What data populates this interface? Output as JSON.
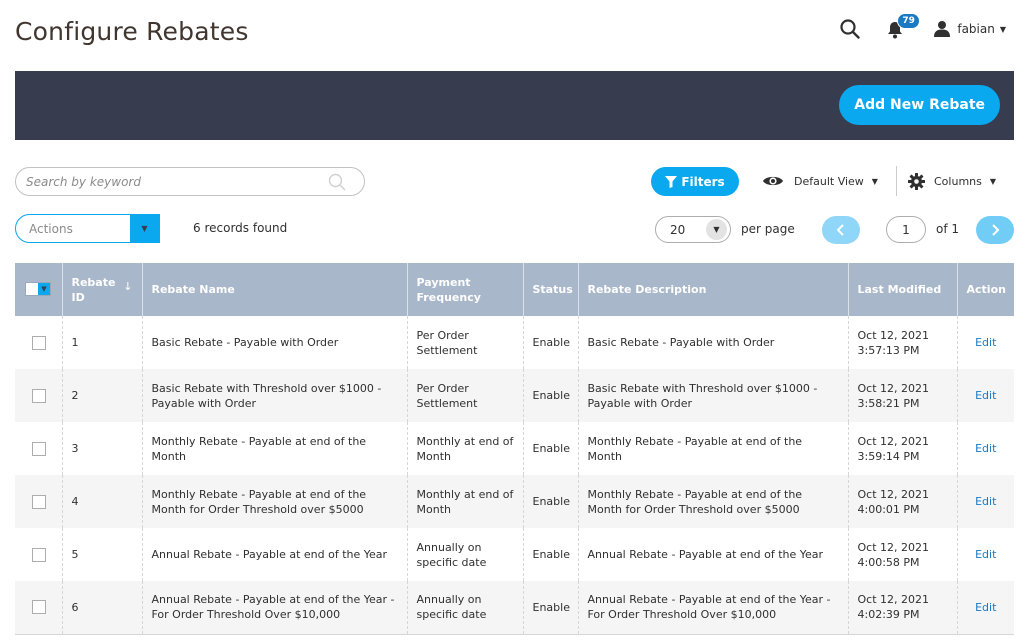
{
  "page": {
    "title": "Configure Rebates"
  },
  "header": {
    "notifications_count": "79",
    "username": "fabian"
  },
  "toolbar": {
    "add_button": "Add New Rebate",
    "search_placeholder": "Search by keyword",
    "filters_label": "Filters",
    "view_label": "Default View",
    "columns_label": "Columns",
    "actions_label": "Actions",
    "records_found": "6 records found",
    "per_page_value": "20",
    "per_page_label": "per page",
    "current_page": "1",
    "total_pages_label": "of 1"
  },
  "grid": {
    "columns": [
      "Rebate ID",
      "Rebate Name",
      "Payment Frequency",
      "Status",
      "Rebate Description",
      "Last Modified",
      "Action"
    ],
    "rows": [
      {
        "id": "1",
        "name": "Basic Rebate - Payable with Order",
        "frequency": "Per Order Settlement",
        "status": "Enable",
        "description": "Basic Rebate - Payable with Order",
        "modified_date": "Oct 12, 2021",
        "modified_time": "3:57:13 PM",
        "action": "Edit"
      },
      {
        "id": "2",
        "name": "Basic Rebate with Threshold over $1000 - Payable with Order",
        "frequency": "Per Order Settlement",
        "status": "Enable",
        "description": "Basic Rebate with Threshold over $1000 - Payable with Order",
        "modified_date": "Oct 12, 2021",
        "modified_time": "3:58:21 PM",
        "action": "Edit"
      },
      {
        "id": "3",
        "name": "Monthly Rebate - Payable at end of the Month",
        "frequency": "Monthly at end of Month",
        "status": "Enable",
        "description": "Monthly Rebate - Payable at end of the Month",
        "modified_date": "Oct 12, 2021",
        "modified_time": "3:59:14 PM",
        "action": "Edit"
      },
      {
        "id": "4",
        "name": "Monthly Rebate - Payable at end of the Month for Order Threshold over $5000",
        "frequency": "Monthly at end of Month",
        "status": "Enable",
        "description": "Monthly Rebate - Payable at end of the Month for Order Threshold over $5000",
        "modified_date": "Oct 12, 2021",
        "modified_time": "4:00:01 PM",
        "action": "Edit"
      },
      {
        "id": "5",
        "name": "Annual Rebate - Payable at end of the Year",
        "frequency": "Annually on specific date",
        "status": "Enable",
        "description": "Annual Rebate - Payable at end of the Year",
        "modified_date": "Oct 12, 2021",
        "modified_time": "4:00:58 PM",
        "action": "Edit"
      },
      {
        "id": "6",
        "name": "Annual Rebate - Payable at end of the Year - For Order Threshold Over $10,000",
        "frequency": "Annually on specific date",
        "status": "Enable",
        "description": "Annual Rebate - Payable at end of the Year - For Order Threshold Over $10,000",
        "modified_date": "Oct 12, 2021",
        "modified_time": "4:02:39 PM",
        "action": "Edit"
      }
    ]
  },
  "icons": {
    "search": "search-icon",
    "bell": "bell-icon",
    "user": "user-icon",
    "filter": "filter-icon",
    "eye": "eye-icon",
    "gear": "gear-icon",
    "prev": "chevron-left-icon",
    "next": "chevron-right-icon"
  },
  "colors": {
    "accent": "#0aa8ef",
    "banner": "#373c4f",
    "table_header": "#a8b7ca",
    "link": "#1979c3"
  }
}
